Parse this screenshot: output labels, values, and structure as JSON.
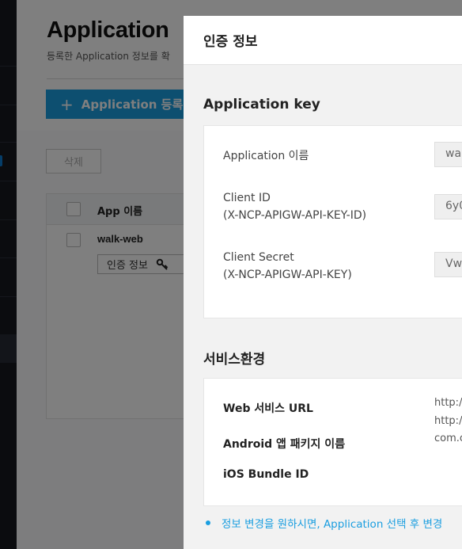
{
  "page": {
    "title": "Application",
    "subtitle": "등록한 Application 정보를 확",
    "register_label": "Application 등록",
    "delete_label": "삭제",
    "table": {
      "column_app_name": "App 이름",
      "rows": [
        {
          "name": "walk-web",
          "credential_label": "인증 정보"
        }
      ]
    }
  },
  "modal": {
    "title": "인증 정보",
    "app_key": {
      "heading": "Application key",
      "fields": [
        {
          "label": "Application 이름",
          "value": "wal"
        },
        {
          "label": "Client ID",
          "sublabel": "(X-NCP-APIGW-API-KEY-ID)",
          "value": "6y0"
        },
        {
          "label": "Client Secret",
          "sublabel": "(X-NCP-APIGW-API-KEY)",
          "value": "Vw"
        }
      ]
    },
    "service_env": {
      "heading": "서비스환경",
      "web_url_label": "Web 서비스 URL",
      "android_label": "Android 앱 패키지 이름",
      "ios_label": "iOS Bundle ID",
      "values": [
        "http:/",
        "http:/",
        "com.c"
      ]
    },
    "note": "정보 변경을 원하시면, Application 선택 후 변경"
  },
  "colors": {
    "accent": "#1a9ee0",
    "sidenav": "#16191f",
    "overlay": "rgba(0,0,0,0.5)"
  }
}
